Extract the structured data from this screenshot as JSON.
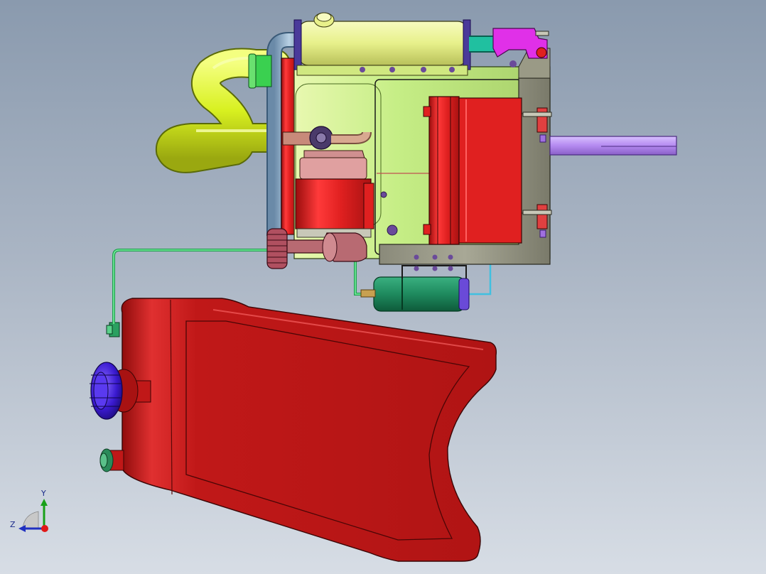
{
  "viewport": {
    "colors": {
      "background_top": "#8a9aae",
      "background_bottom": "#d7dde5",
      "tank_body": "#c01818",
      "muffler": "#e9f28a",
      "crankcase": "#c8ef8a",
      "cylinder_head": "#e02020",
      "fuel_line": "#30d060",
      "filter": "#1e8a5e",
      "shaft": "#b88aef",
      "cap": "#3a1ad0"
    },
    "triad": {
      "y_label": "Y",
      "z_label": "Z"
    }
  }
}
